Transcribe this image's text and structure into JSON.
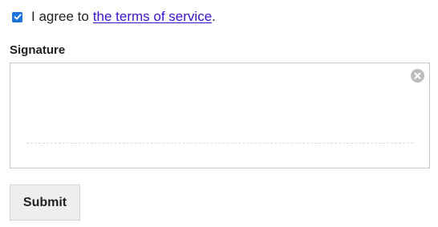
{
  "agreement": {
    "checked": true,
    "text_prefix": "I agree to",
    "link_text": "the terms of service",
    "text_suffix": ".",
    "checkbox_color": "#1e74d6",
    "link_color": "#3b14c9"
  },
  "signature": {
    "label": "Signature",
    "clear_icon": "clear-circle-x-icon"
  },
  "form": {
    "submit_label": "Submit"
  }
}
